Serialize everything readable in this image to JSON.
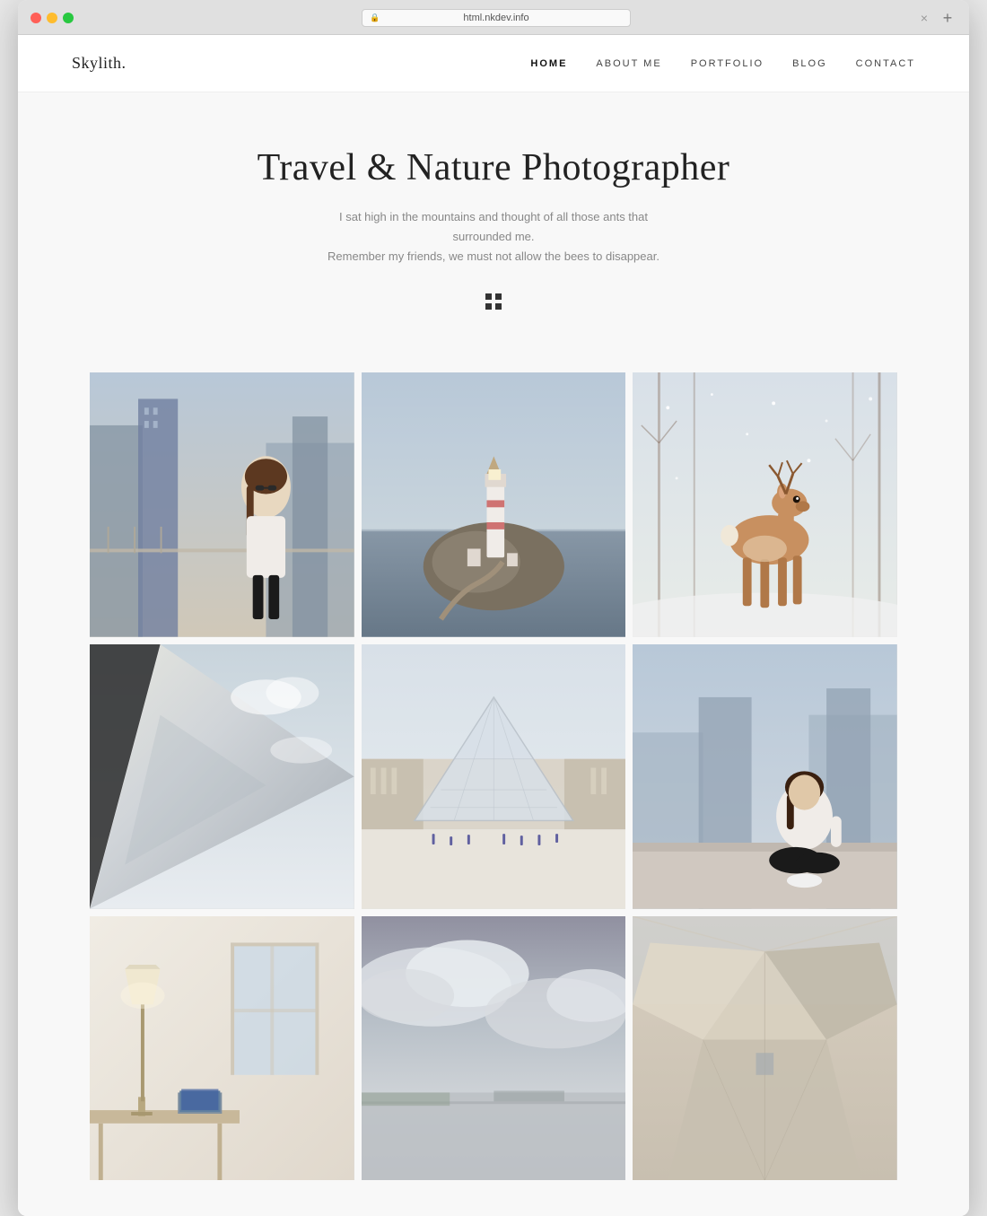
{
  "browser": {
    "url": "html.nkdev.info",
    "close_label": "×",
    "new_tab_label": "+"
  },
  "site": {
    "logo": "Skylith.",
    "nav": {
      "items": [
        {
          "label": "HOME",
          "active": true
        },
        {
          "label": "ABOUT ME",
          "active": false
        },
        {
          "label": "PORTFOLIO",
          "active": false
        },
        {
          "label": "BLOG",
          "active": false
        },
        {
          "label": "CONTACT",
          "active": false
        }
      ]
    },
    "hero": {
      "title": "Travel & Nature Photographer",
      "subtitle_line1": "I sat high in the mountains and thought of all those ants that surrounded me.",
      "subtitle_line2": "Remember my friends, we must not allow the bees to disappear."
    },
    "gallery": {
      "photos": [
        {
          "id": 1,
          "alt": "Woman with sunglasses in city",
          "class": "photo-1"
        },
        {
          "id": 2,
          "alt": "Lighthouse on rocky coast",
          "class": "photo-2"
        },
        {
          "id": 3,
          "alt": "Deer in snowy forest",
          "class": "photo-3"
        },
        {
          "id": 4,
          "alt": "Sail fabric closeup",
          "class": "photo-4"
        },
        {
          "id": 5,
          "alt": "Louvre pyramid Paris",
          "class": "photo-5"
        },
        {
          "id": 6,
          "alt": "Woman sitting on urban terrace",
          "class": "photo-6"
        },
        {
          "id": 7,
          "alt": "Interior lamp on table",
          "class": "photo-7"
        },
        {
          "id": 8,
          "alt": "Cloudy sky landscape",
          "class": "photo-8"
        },
        {
          "id": 9,
          "alt": "Geometric architecture",
          "class": "photo-9"
        }
      ]
    }
  }
}
